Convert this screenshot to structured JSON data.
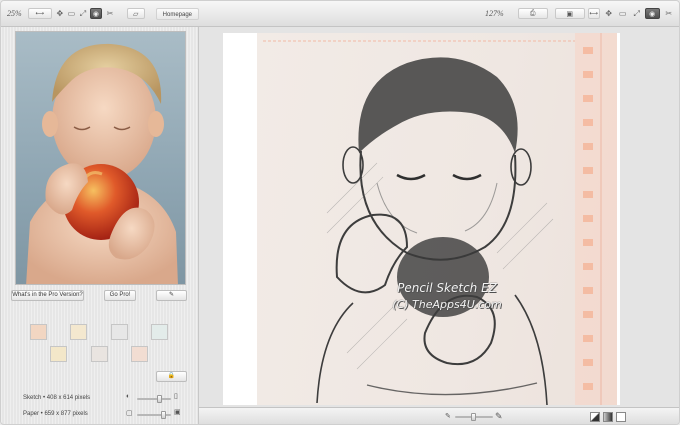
{
  "left_toolbar": {
    "zoom": "25%",
    "icons": [
      "arrows-horizontal-icon",
      "move-icon",
      "fit-icon",
      "expand-icon",
      "camera-icon",
      "scissors-icon",
      "folder-icon"
    ],
    "homepage_label": "Homepage"
  },
  "right_toolbar": {
    "zoom": "127%",
    "icons": [
      "print-icon",
      "save-icon",
      "arrows-horizontal-icon",
      "move-icon",
      "fit-icon",
      "expand-icon",
      "camera-icon",
      "scissors-icon"
    ]
  },
  "left_panel": {
    "pro_version_label": "What's in the Pro Version?",
    "go_pro_label": "Go Pro!",
    "swatch_colors": [
      "#f2d6c2",
      "#f4e8cf",
      "#e7e7e7",
      "#e3ecea",
      "#f3e7c9",
      "#e9e4e0",
      "#f2ddd2"
    ],
    "sketch_info": "Sketch  •  408 x 614  pixels",
    "paper_info": "Paper  •  659 x 877  pixels"
  },
  "canvas": {
    "watermark_line1": "Pencil Sketch EZ",
    "watermark_line2": "(C) TheApps4U.com"
  },
  "colors": {
    "accent_pink": "#f3b9a4",
    "sketch_ink": "#3d3d3d"
  }
}
